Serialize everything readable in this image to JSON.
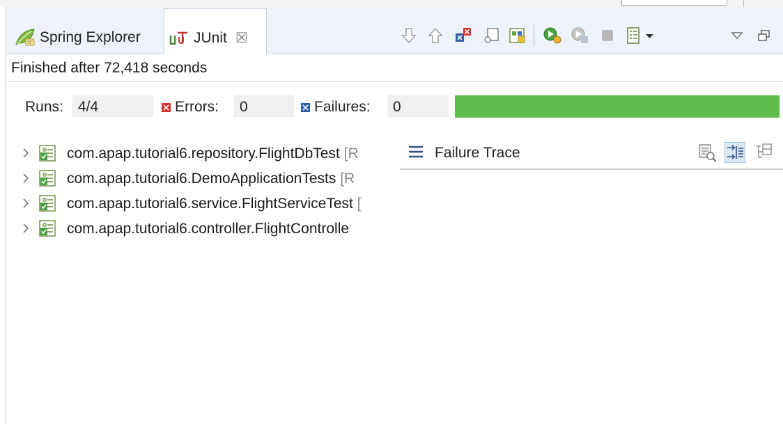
{
  "tabs": [
    {
      "label": "Spring Explorer",
      "icon": "spring-leaf-icon",
      "active": false
    },
    {
      "label": "JUnit",
      "icon": "junit-icon",
      "active": true,
      "close_icon": "close-icon"
    }
  ],
  "toolbar": {
    "icons": [
      "next-failure-icon",
      "previous-failure-icon",
      "show-failures-only-icon",
      "scroll-lock-icon",
      "show-skipped-icon",
      "rerun-test-icon",
      "rerun-failures-first-icon",
      "stop-icon",
      "test-run-history-icon",
      "history-dropdown-icon",
      "view-menu-icon",
      "maximize-icon"
    ]
  },
  "status": {
    "text": "Finished after 72,418 seconds"
  },
  "counters": {
    "runs_label": "Runs:",
    "runs_value": "4/4",
    "errors_label": "Errors:",
    "errors_value": "0",
    "failures_label": "Failures:",
    "failures_value": "0",
    "progress_fraction": 1.0,
    "progress_color": "#5cbd4a"
  },
  "tree": {
    "items": [
      {
        "name": "com.apap.tutorial6.repository.FlightDbTest",
        "extra": " [R"
      },
      {
        "name": "com.apap.tutorial6.DemoApplicationTests",
        "extra": " [R"
      },
      {
        "name": "com.apap.tutorial6.service.FlightServiceTest",
        "extra": " ["
      },
      {
        "name": "com.apap.tutorial6.controller.FlightControlle",
        "extra": ""
      }
    ]
  },
  "trace": {
    "title": "Failure Trace",
    "icons": [
      "compare-results-icon",
      "filter-stack-trace-icon",
      "copy-trace-icon"
    ]
  }
}
